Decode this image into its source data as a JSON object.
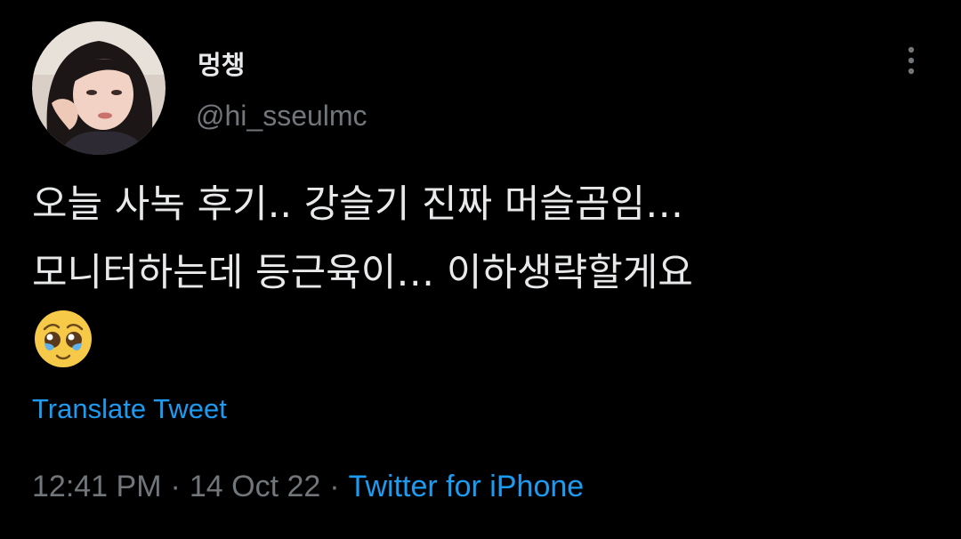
{
  "user": {
    "display_name": "멍챙",
    "handle": "@hi_sseulmc",
    "avatar_icon": "profile-photo-avatar"
  },
  "tweet": {
    "lines": [
      "오늘 사녹 후기.. 강슬기 진짜 머슬곰임…",
      "모니터하는데 등근육이… 이하생략할게요"
    ],
    "emoji": "pleading-face-with-tears-emoji"
  },
  "actions": {
    "more_icon": "more-vertical-icon",
    "translate_label": "Translate Tweet"
  },
  "meta": {
    "time": "12:41 PM",
    "separator": "·",
    "date": "14 Oct 22",
    "source": "Twitter for iPhone"
  },
  "colors": {
    "background": "#000000",
    "primary_text": "#e7e9ea",
    "secondary_text": "#71767b",
    "link": "#1d9bf0"
  }
}
